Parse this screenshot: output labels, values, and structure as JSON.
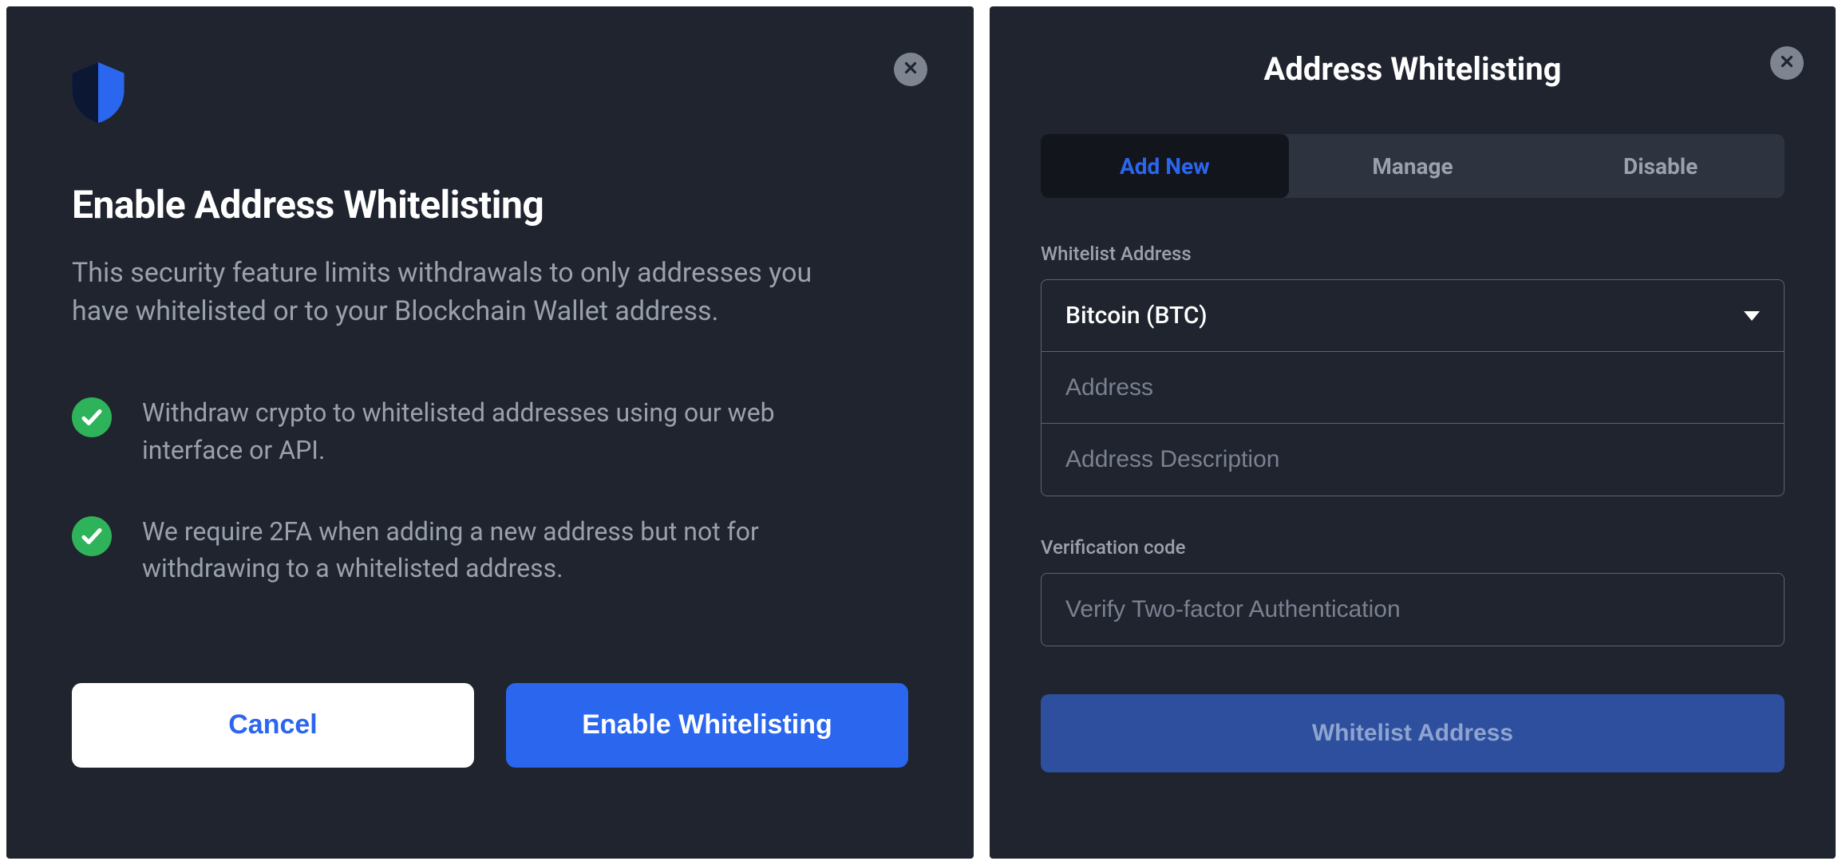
{
  "left": {
    "title": "Enable Address Whitelisting",
    "description": "This security feature limits withdrawals to only addresses you have whitelisted or to your Blockchain Wallet address.",
    "bullets": [
      "Withdraw crypto to whitelisted addresses using our web interface or API.",
      "We require 2FA when adding a new address but not for withdrawing to a whitelisted address."
    ],
    "cancel_label": "Cancel",
    "enable_label": "Enable Whitelisting"
  },
  "right": {
    "title": "Address Whitelisting",
    "tabs": [
      {
        "label": "Add New",
        "active": true
      },
      {
        "label": "Manage",
        "active": false
      },
      {
        "label": "Disable",
        "active": false
      }
    ],
    "whitelist_label": "Whitelist Address",
    "currency_selected": "Bitcoin (BTC)",
    "address_placeholder": "Address",
    "description_placeholder": "Address Description",
    "verification_label": "Verification code",
    "verification_placeholder": "Verify Two-factor Authentication",
    "submit_label": "Whitelist Address"
  },
  "icons": {
    "shield": "shield-icon",
    "close": "close-icon",
    "check": "check-icon",
    "caret": "chevron-down-icon"
  },
  "colors": {
    "panel_bg": "#1f242e",
    "accent_blue": "#2a66ee",
    "success_green": "#2eb35a",
    "muted_text": "#9aa1ad",
    "disabled_submit_bg": "#2d4f9e"
  }
}
